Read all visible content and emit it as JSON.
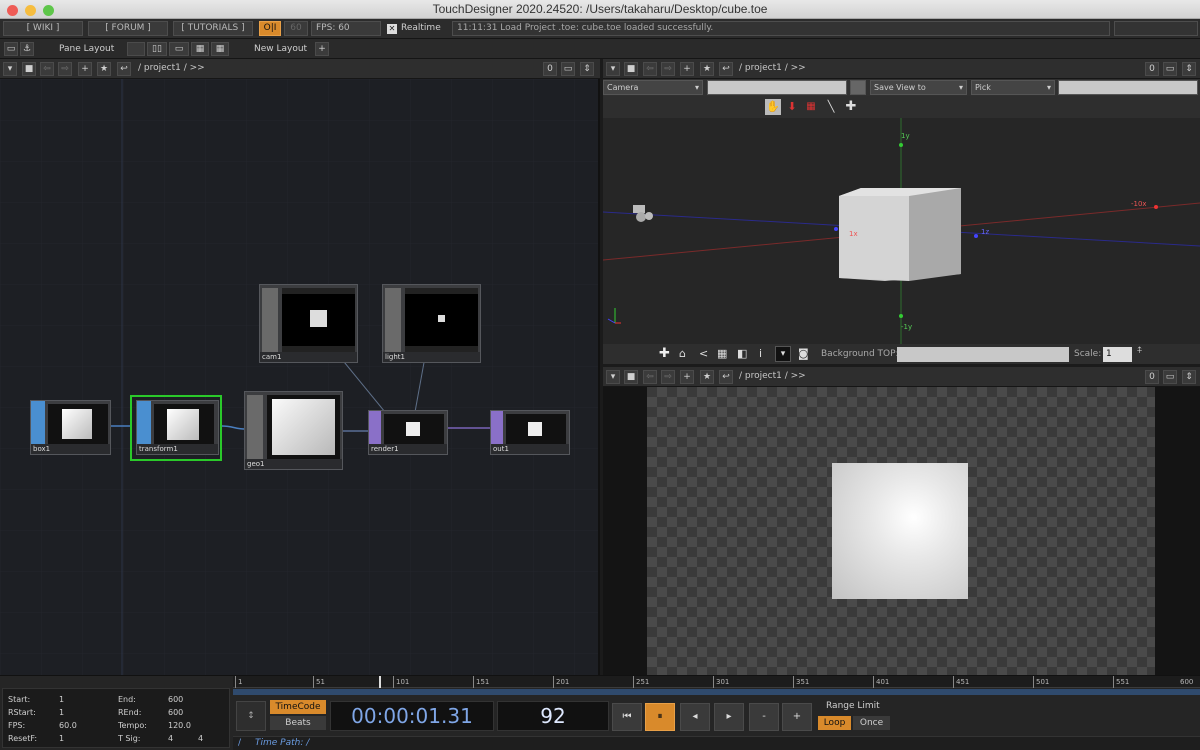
{
  "window": {
    "title": "TouchDesigner 2020.24520: /Users/takaharu/Desktop/cube.toe"
  },
  "topbar": {
    "wiki": "[ WIKI ]",
    "forum": "[ FORUM ]",
    "tutorials": "[ TUTORIALS ]",
    "oi": "O|I",
    "fps_value": "60",
    "fps_label": "FPS:  60",
    "realtime_label": "Realtime",
    "status_message": "11:11:31 Load Project .toe: cube.toe loaded successfully."
  },
  "layoutbar": {
    "pane_layout": "Pane Layout",
    "new_layout": "New Layout",
    "plus": "+"
  },
  "network_pane": {
    "path": "/ project1 / >>",
    "counter": "0"
  },
  "nodes": [
    {
      "name": "box1",
      "color": "#4a8fd0"
    },
    {
      "name": "transform1",
      "color": "#4a8fd0"
    },
    {
      "name": "geo1",
      "color": "#7a7a7a"
    },
    {
      "name": "cam1",
      "color": "#7a7a7a"
    },
    {
      "name": "light1",
      "color": "#7a7a7a"
    },
    {
      "name": "render1",
      "color": "#8a70c8"
    },
    {
      "name": "out1",
      "color": "#8a70c8"
    }
  ],
  "viewer_pane": {
    "path": "/ project1 / >>",
    "counter": "0",
    "camera_select": "Camera",
    "save_view": "Save View to",
    "pick": "Pick",
    "axis_labels": {
      "y_top": "1y",
      "y_bottom": "-1y",
      "x": "1x",
      "neg_x": "-10x",
      "z": "1z"
    },
    "background_top_label": "Background TOP:",
    "scale_label": "Scale:",
    "scale_value": "1"
  },
  "output_pane": {
    "path": "/ project1 / >>",
    "counter": "0"
  },
  "timeline": {
    "ruler_ticks": [
      "1",
      "51",
      "101",
      "151",
      "201",
      "251",
      "301",
      "351",
      "401",
      "451",
      "501",
      "551",
      "600"
    ],
    "info": {
      "start_label": "Start:",
      "start": "1",
      "end_label": "End:",
      "end": "600",
      "rstart_label": "RStart:",
      "rstart": "1",
      "rend_label": "REnd:",
      "rend": "600",
      "fps_label": "FPS:",
      "fps": "60.0",
      "tempo_label": "Tempo:",
      "tempo": "120.0",
      "resetf_label": "ResetF:",
      "resetf": "1",
      "tsig_label": "T Sig:",
      "tsig_a": "4",
      "tsig_b": "4"
    },
    "timecode_label": "TimeCode",
    "beats_label": "Beats",
    "timecode": "00:00:01.31",
    "frame": "92",
    "range_limit": "Range Limit",
    "loop": "Loop",
    "once": "Once",
    "time_path": "Time Path: /"
  }
}
